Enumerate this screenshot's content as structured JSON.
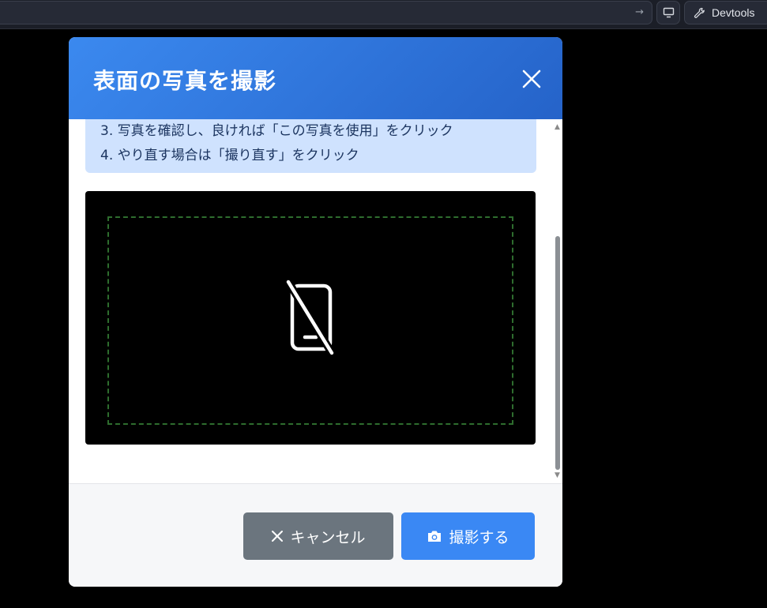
{
  "browser": {
    "devtools_label": "Devtools"
  },
  "modal": {
    "title": "表面の写真を撮影",
    "instructions": [
      "3. 写真を確認し、良ければ「この写真を使用」をクリック",
      "4. やり直す場合は「撮り直す」をクリック"
    ],
    "camera": {
      "status_icon": "no-camera-icon"
    }
  },
  "footer": {
    "cancel_label": "キャンセル",
    "capture_label": "撮影する"
  },
  "colors": {
    "header_gradient_start": "#3b89ef",
    "header_gradient_end": "#2563c9",
    "cancel_button": "#6b757e",
    "capture_button": "#3a88f4",
    "instructions_bg": "#cfe2fe",
    "guide_frame": "#2e6d2e"
  }
}
